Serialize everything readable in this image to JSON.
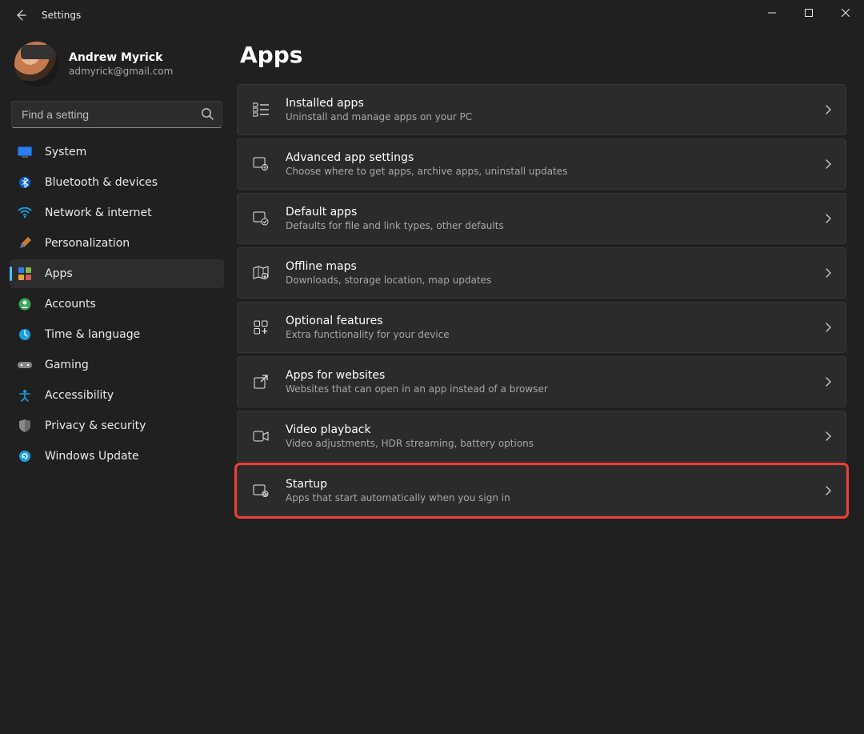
{
  "window": {
    "title": "Settings"
  },
  "profile": {
    "name": "Andrew Myrick",
    "email": "admyrick@gmail.com"
  },
  "search": {
    "placeholder": "Find a setting"
  },
  "sidebar": {
    "items": [
      {
        "label": "System",
        "selected": false
      },
      {
        "label": "Bluetooth & devices",
        "selected": false
      },
      {
        "label": "Network & internet",
        "selected": false
      },
      {
        "label": "Personalization",
        "selected": false
      },
      {
        "label": "Apps",
        "selected": true
      },
      {
        "label": "Accounts",
        "selected": false
      },
      {
        "label": "Time & language",
        "selected": false
      },
      {
        "label": "Gaming",
        "selected": false
      },
      {
        "label": "Accessibility",
        "selected": false
      },
      {
        "label": "Privacy & security",
        "selected": false
      },
      {
        "label": "Windows Update",
        "selected": false
      }
    ]
  },
  "page": {
    "title": "Apps",
    "cards": [
      {
        "title": "Installed apps",
        "desc": "Uninstall and manage apps on your PC",
        "highlight": false
      },
      {
        "title": "Advanced app settings",
        "desc": "Choose where to get apps, archive apps, uninstall updates",
        "highlight": false
      },
      {
        "title": "Default apps",
        "desc": "Defaults for file and link types, other defaults",
        "highlight": false
      },
      {
        "title": "Offline maps",
        "desc": "Downloads, storage location, map updates",
        "highlight": false
      },
      {
        "title": "Optional features",
        "desc": "Extra functionality for your device",
        "highlight": false
      },
      {
        "title": "Apps for websites",
        "desc": "Websites that can open in an app instead of a browser",
        "highlight": false
      },
      {
        "title": "Video playback",
        "desc": "Video adjustments, HDR streaming, battery options",
        "highlight": false
      },
      {
        "title": "Startup",
        "desc": "Apps that start automatically when you sign in",
        "highlight": true
      }
    ]
  },
  "highlight_color": "#ef3e36"
}
